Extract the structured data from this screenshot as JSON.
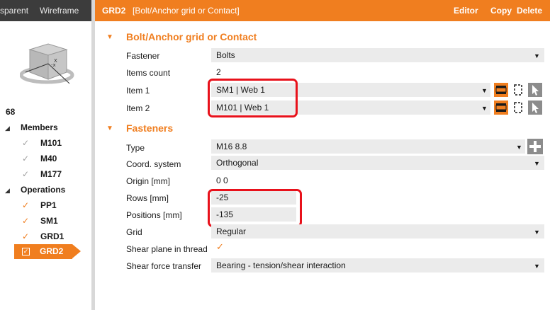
{
  "left_panel": {
    "view_tabs": [
      "sparent",
      "Wireframe"
    ],
    "cube_axis_label": "X",
    "project_number": "68",
    "members_label": "Members",
    "members": [
      "M101",
      "M40",
      "M177"
    ],
    "operations_label": "Operations",
    "operations": [
      "PP1",
      "SM1",
      "GRD1",
      "GRD2"
    ],
    "selected_operation": "GRD2"
  },
  "header": {
    "name": "GRD2",
    "subtitle": "[Bolt/Anchor grid or Contact]",
    "actions": [
      "Editor",
      "Copy",
      "Delete"
    ]
  },
  "section_bolt": {
    "title": "Bolt/Anchor grid or Contact",
    "fastener_label": "Fastener",
    "fastener_value": "Bolts",
    "items_count_label": "Items count",
    "items_count_value": "2",
    "item1_label": "Item 1",
    "item1_value": "SM1 | Web 1",
    "item2_label": "Item 2",
    "item2_value": "M101 | Web 1"
  },
  "section_fasteners": {
    "title": "Fasteners",
    "type_label": "Type",
    "type_value": "M16 8.8",
    "coord_label": "Coord. system",
    "coord_value": "Orthogonal",
    "origin_label": "Origin [mm]",
    "origin_value": "0 0",
    "rows_label": "Rows [mm]",
    "rows_value": "-25",
    "positions_label": "Positions [mm]",
    "positions_value": "-135",
    "grid_label": "Grid",
    "grid_value": "Regular",
    "shear_thread_label": "Shear plane in thread",
    "shear_thread_checked": true,
    "shear_force_label": "Shear force transfer",
    "shear_force_value": "Bearing - tension/shear interaction"
  },
  "colors": {
    "accent": "#f07e1f",
    "highlight": "#e8111b",
    "field_bg": "#ebebeb"
  }
}
